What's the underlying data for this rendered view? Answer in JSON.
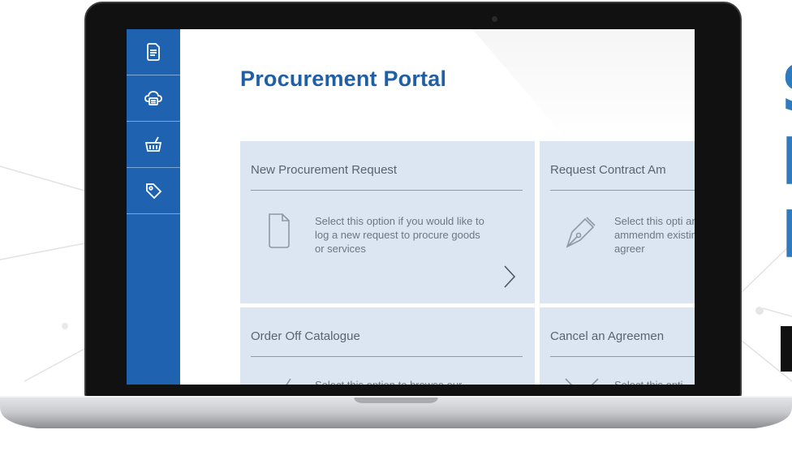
{
  "app": {
    "title": "Procurement Portal"
  },
  "sidebar": {
    "items": [
      {
        "icon": "document-icon"
      },
      {
        "icon": "cloud-printer-icon"
      },
      {
        "icon": "basket-icon"
      },
      {
        "icon": "tag-icon"
      }
    ]
  },
  "tiles": [
    {
      "title": "New Procurement Request",
      "description": "Select this option if you would like to log a new request to procure goods or services",
      "icon": "document-outline-icon",
      "arrow_icon": "chevron-right-icon"
    },
    {
      "title": "Request Contract Am",
      "description": "Select this opti and ammendm existing agreer",
      "icon": "pen-nib-icon"
    },
    {
      "title": "Order Off Catalogue",
      "description": "Select this option to browse our catalogue of pre-approved",
      "icon": "basket-outline-icon"
    },
    {
      "title": "Cancel an Agreemen",
      "description": "Select this opti would like to re",
      "icon": "cross-icon"
    }
  ],
  "side_headline": {
    "lines": [
      "S",
      "F",
      "F"
    ]
  },
  "colors": {
    "sidebar": "#1f63b0",
    "tile": "#dbe6f2",
    "title": "#1f5fa6",
    "headline": "#2e7bbf"
  }
}
